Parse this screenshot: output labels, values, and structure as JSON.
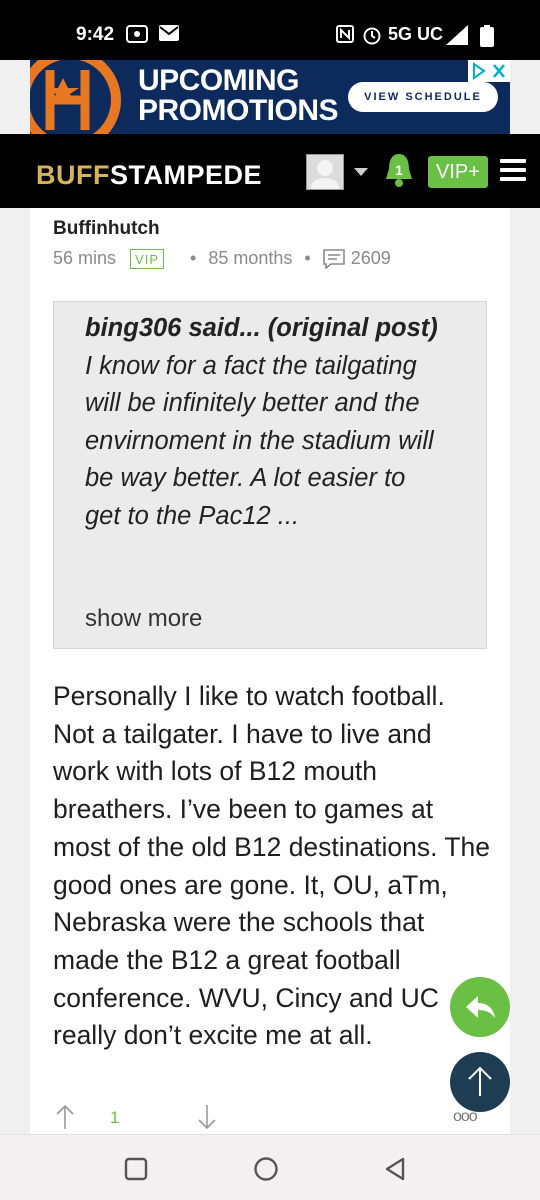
{
  "status_bar": {
    "time": "9:42",
    "network": "5G UC"
  },
  "ad": {
    "headline_line1": "UPCOMING",
    "headline_line2": "PROMOTIONS",
    "cta": "VIEW SCHEDULE"
  },
  "header": {
    "brand_part1": "BUFF",
    "brand_part2": "STAMPEDE",
    "notification_count": "1",
    "vip_label": "VIP+"
  },
  "post": {
    "author": "Buffinhutch",
    "time_ago": "56 mins",
    "badge": "VIP",
    "tenure": "85 months",
    "post_count": "2609",
    "quote": {
      "author_label": "bing306 said... (original post)",
      "text": " I know for a fact the tailgating will be infinitely better and the envirnoment in the stadium will be way better. A lot easier to get to the Pac12 ...",
      "show_more": "show more"
    },
    "body": "Personally I like to watch football. Not a tailgater. I have to live and work with lots of B12 mouth breathers. I’ve been to games at most of the old B12 destinations. The good ones are gone. It, OU, aTm, Nebraska were the schools that made the B12 a great football conference. WVU, Cincy and UC really don’t excite me at all.",
    "vote_count": "1",
    "more": "ooo"
  },
  "colors": {
    "accent_green": "#6abf45",
    "brand_gold": "#d6b25a",
    "fab_dark": "#1e3d52"
  }
}
